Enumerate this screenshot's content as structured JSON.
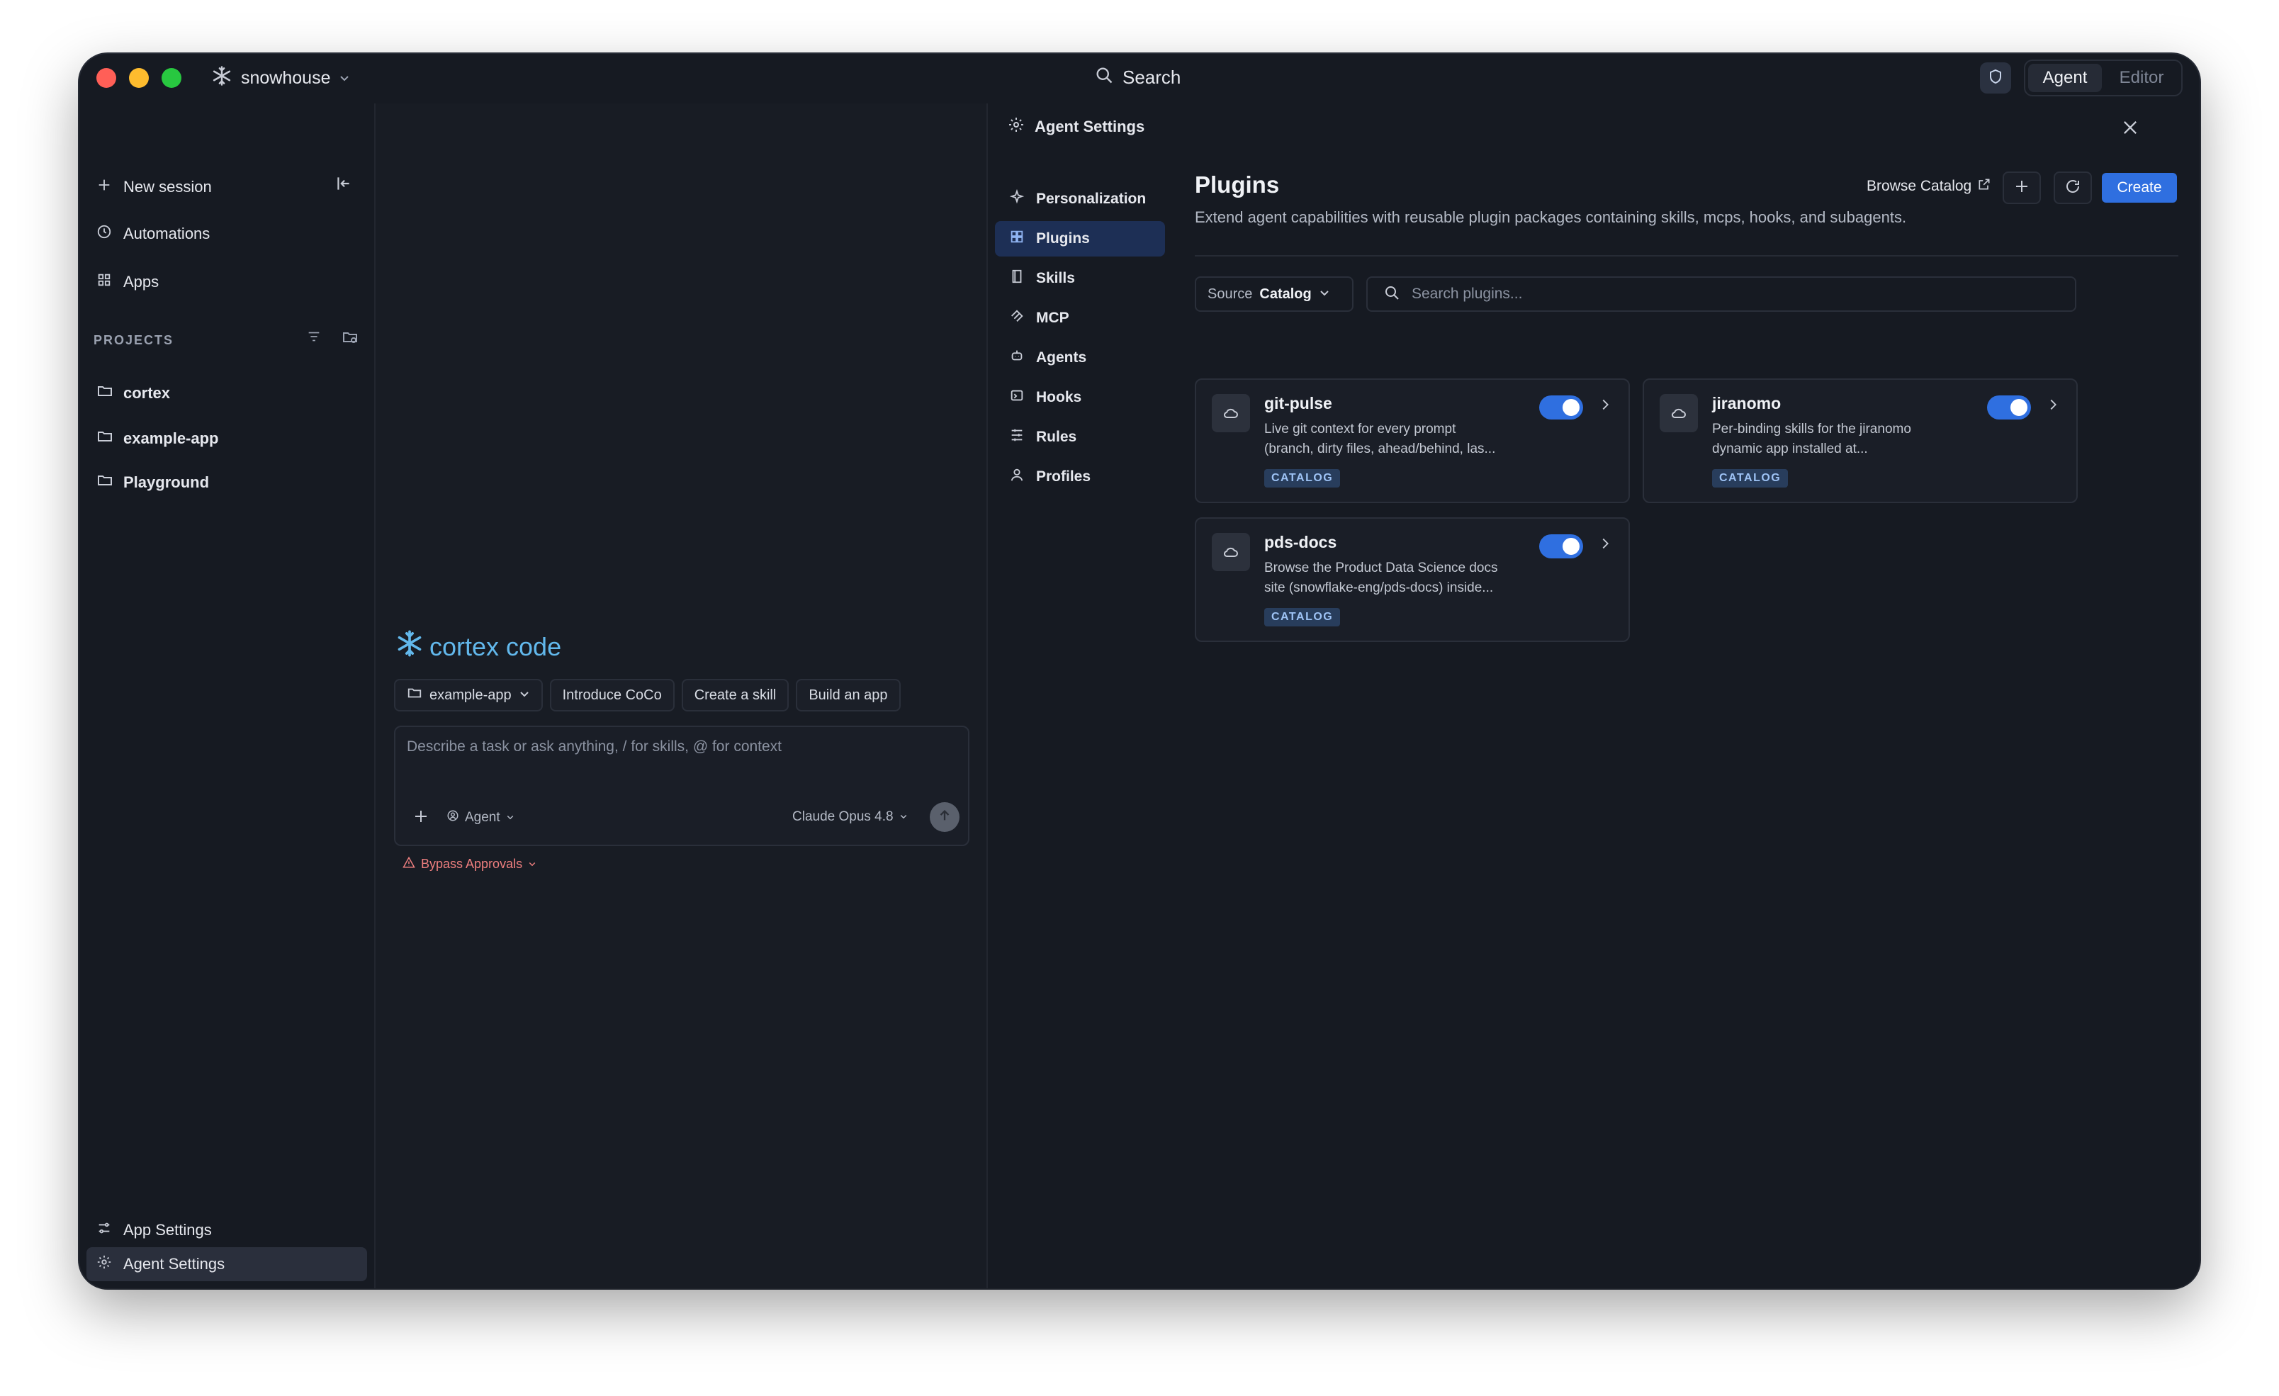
{
  "titlebar": {
    "org_name": "snowhouse",
    "search_label": "Search",
    "modes": [
      "Agent",
      "Editor"
    ],
    "active_mode": "Agent"
  },
  "sidebar": {
    "new_session": "New session",
    "automations": "Automations",
    "apps": "Apps",
    "projects_header": "PROJECTS",
    "projects": [
      "cortex",
      "example-app",
      "Playground"
    ],
    "app_settings": "App Settings",
    "agent_settings": "Agent Settings"
  },
  "chat": {
    "logo_text": "cortex code",
    "project_chip": "example-app",
    "quick_actions": [
      "Introduce CoCo",
      "Create a skill",
      "Build an app"
    ],
    "composer_placeholder": "Describe a task or ask anything, / for skills, @ for context",
    "agent_mode": "Agent",
    "model": "Claude Opus 4.8",
    "bypass_label": "Bypass Approvals"
  },
  "settings": {
    "header": "Agent Settings",
    "nav": [
      "Personalization",
      "Plugins",
      "Skills",
      "MCP",
      "Agents",
      "Hooks",
      "Rules",
      "Profiles"
    ],
    "active_nav": "Plugins",
    "title": "Plugins",
    "description": "Extend agent capabilities with reusable plugin packages containing skills, mcps, hooks, and subagents.",
    "browse_catalog": "Browse Catalog",
    "create_label": "Create",
    "source_label": "Source",
    "source_value": "Catalog",
    "search_placeholder": "Search plugins...",
    "plugins": [
      {
        "name": "git-pulse",
        "desc_line1": "Live git context for every prompt",
        "desc_line2": "(branch, dirty files, ahead/behind, las...",
        "badge": "CATALOG",
        "enabled": true
      },
      {
        "name": "jiranomo",
        "desc_line1": "Per-binding skills for the jiranomo",
        "desc_line2": "dynamic app installed at...",
        "badge": "CATALOG",
        "enabled": true
      },
      {
        "name": "pds-docs",
        "desc_line1": "Browse the Product Data Science docs",
        "desc_line2": "site (snowflake-eng/pds-docs) inside...",
        "badge": "CATALOG",
        "enabled": true
      }
    ]
  },
  "colors": {
    "window_bg": "#161a22",
    "accent": "#2f6fe0",
    "logo": "#62b8ec",
    "warning": "#ef7f7f"
  },
  "right_rail_icons": [
    "file-icon",
    "globe-icon",
    "sql-icon",
    "terminal-icon",
    "git-branch-icon",
    "more-icon"
  ]
}
